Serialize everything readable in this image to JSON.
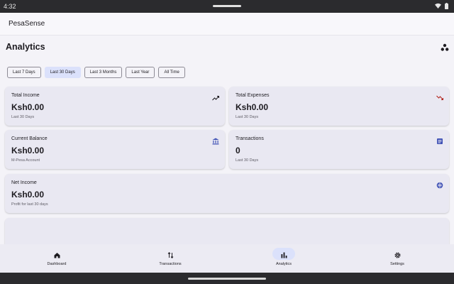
{
  "status_bar": {
    "time": "4:32"
  },
  "app_bar": {
    "title": "PesaSense"
  },
  "header": {
    "title": "Analytics",
    "action_icon": "people-icon"
  },
  "filters": {
    "selected": "Last 30 Days",
    "items": [
      "Last 7 Days",
      "Last 30 Days",
      "Last 3 Months",
      "Last Year",
      "All Time"
    ]
  },
  "cards": {
    "total_income": {
      "title": "Total Income",
      "value": "Ksh0.00",
      "subtitle": "Last 30 Days",
      "icon": "trending-up-icon",
      "icon_color": "#1d1b20"
    },
    "total_expenses": {
      "title": "Total Expenses",
      "value": "Ksh0.00",
      "subtitle": "Last 30 Days",
      "icon": "trending-down-icon",
      "icon_color": "#b3261e"
    },
    "current_balance": {
      "title": "Current Balance",
      "value": "Ksh0.00",
      "subtitle": "M-Pesa Account",
      "icon": "bank-icon",
      "icon_color": "#3f51b5"
    },
    "transactions": {
      "title": "Transactions",
      "value": "0",
      "subtitle": "Last 30 Days",
      "icon": "receipt-icon",
      "icon_color": "#3f51b5"
    },
    "net_income": {
      "title": "Net Income",
      "value": "Ksh0.00",
      "subtitle": "Profit for last 30 days",
      "icon": "savings-icon",
      "icon_color": "#3f51b5"
    }
  },
  "bottom_nav": {
    "active": "Analytics",
    "items": [
      {
        "label": "Dashboard",
        "icon": "home-icon"
      },
      {
        "label": "Transactions",
        "icon": "swap-vertical-icon"
      },
      {
        "label": "Analytics",
        "icon": "bar-chart-icon"
      },
      {
        "label": "Settings",
        "icon": "gear-icon"
      }
    ]
  },
  "colors": {
    "accent": "#dbe1fb",
    "card": "#e9e8f2",
    "background": "#f4f3f8",
    "negative": "#b3261e",
    "brand_blue": "#3f51b5"
  }
}
